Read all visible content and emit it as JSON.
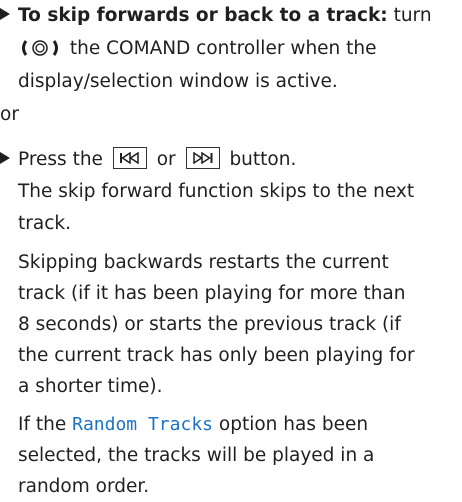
{
  "step1": {
    "title": "To skip forwards or back to a track:",
    "after_title": " turn",
    "line2_after_icon": " the COMAND controller when the",
    "line3": "display/selection window is active."
  },
  "or_text": "or",
  "step2": {
    "prefix": "Press the",
    "middle": "or",
    "suffix": "button."
  },
  "para1": [
    "The skip forward function skips to the next",
    "track."
  ],
  "para2": [
    "Skipping backwards restarts the current",
    "track (if it has been playing for more than",
    "8 seconds) or starts the previous track (if",
    "the current track has only been playing for",
    "a shorter time)."
  ],
  "para3": {
    "line1_prefix": "If the",
    "option_name": "Random Tracks",
    "line1_suffix": "option has been",
    "line2": "selected, the tracks will be played in a",
    "line3": "random order."
  },
  "colors": {
    "option_highlight": "#1a73c7"
  },
  "icons": [
    "bullet-triangle-icon",
    "controller-rotate-icon",
    "skip-back-icon",
    "skip-forward-icon"
  ]
}
